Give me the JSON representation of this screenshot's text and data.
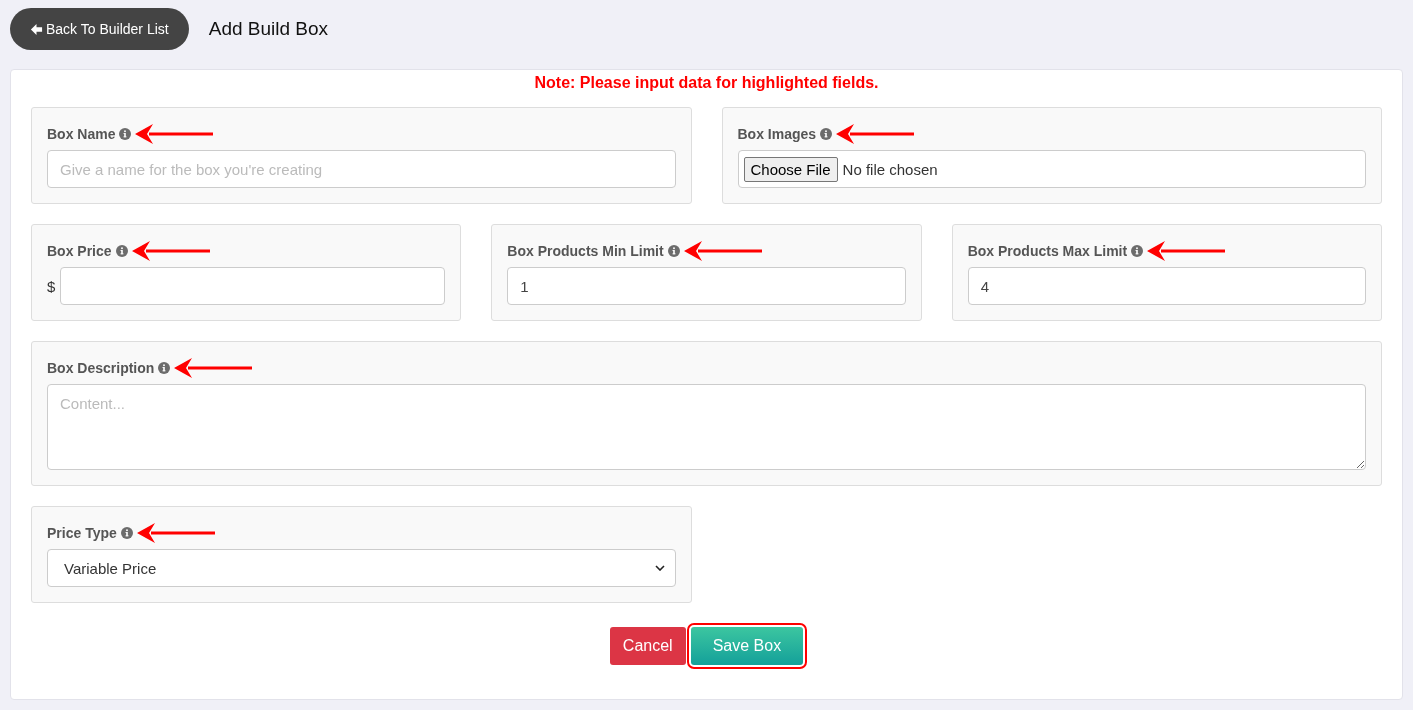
{
  "header": {
    "back_button": "Back To Builder List",
    "title": "Add Build Box"
  },
  "note": "Note: Please input data for highlighted fields.",
  "rows": [
    {
      "fields": [
        {
          "kind": "text",
          "label": "Box Name",
          "highlighted": true,
          "placeholder": "Give a name for the box you're creating"
        },
        {
          "kind": "file",
          "label": "Box Images",
          "highlighted": true,
          "button": "Choose File",
          "status": "No file chosen"
        }
      ]
    },
    {
      "fields": [
        {
          "kind": "price",
          "label": "Box Price",
          "highlighted": true,
          "prefix": "$"
        },
        {
          "kind": "number",
          "label": "Box Products Min Limit",
          "highlighted": true,
          "value": "1"
        },
        {
          "kind": "number",
          "label": "Box Products Max Limit",
          "highlighted": true,
          "value": "4"
        }
      ]
    },
    {
      "fields": [
        {
          "kind": "textarea",
          "label": "Box Description",
          "highlighted": true,
          "placeholder": "Content..."
        }
      ]
    },
    {
      "fields": [
        {
          "kind": "select",
          "label": "Price Type",
          "highlighted": true,
          "value": "Variable Price"
        }
      ]
    }
  ],
  "buttons": [
    {
      "kind": "cancel",
      "label": "Cancel",
      "highlighted": false
    },
    {
      "kind": "save",
      "label": "Save Box",
      "highlighted": true
    }
  ]
}
